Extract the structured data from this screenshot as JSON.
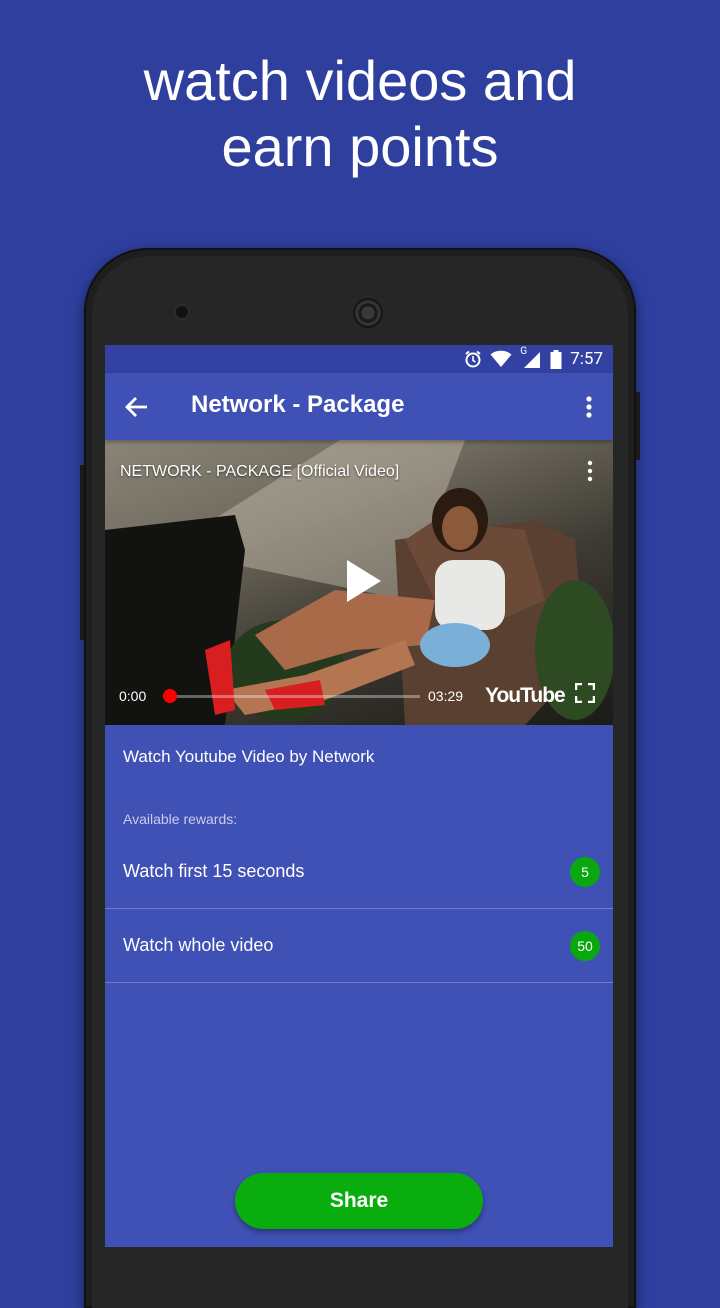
{
  "promo": {
    "headline_line1": "watch videos and",
    "headline_line2": "earn points"
  },
  "statusbar": {
    "time": "7:57",
    "icons": [
      "alarm-icon",
      "wifi-icon",
      "signal-icon",
      "battery-icon"
    ],
    "network_label": "G"
  },
  "toolbar": {
    "title": "Network - Package",
    "back_icon": "arrow-back-icon",
    "menu_icon": "more-vert-icon"
  },
  "video": {
    "title": "NETWORK - PACKAGE [Official Video]",
    "current_time": "0:00",
    "duration": "03:29",
    "brand": "YouTube",
    "progress": 0
  },
  "content": {
    "description": "Watch Youtube Video by Network",
    "rewards_label": "Available rewards:",
    "rewards": [
      {
        "label": "Watch first 15 seconds",
        "points": "5"
      },
      {
        "label": "Watch whole video",
        "points": "50"
      }
    ],
    "share_label": "Share"
  },
  "colors": {
    "background": "#2f3f9e",
    "primary": "#3f51b5",
    "status_bar": "#3341a3",
    "badge": "#09a80f",
    "share_button": "#09ae0e",
    "progress_knob": "#ff0000"
  }
}
